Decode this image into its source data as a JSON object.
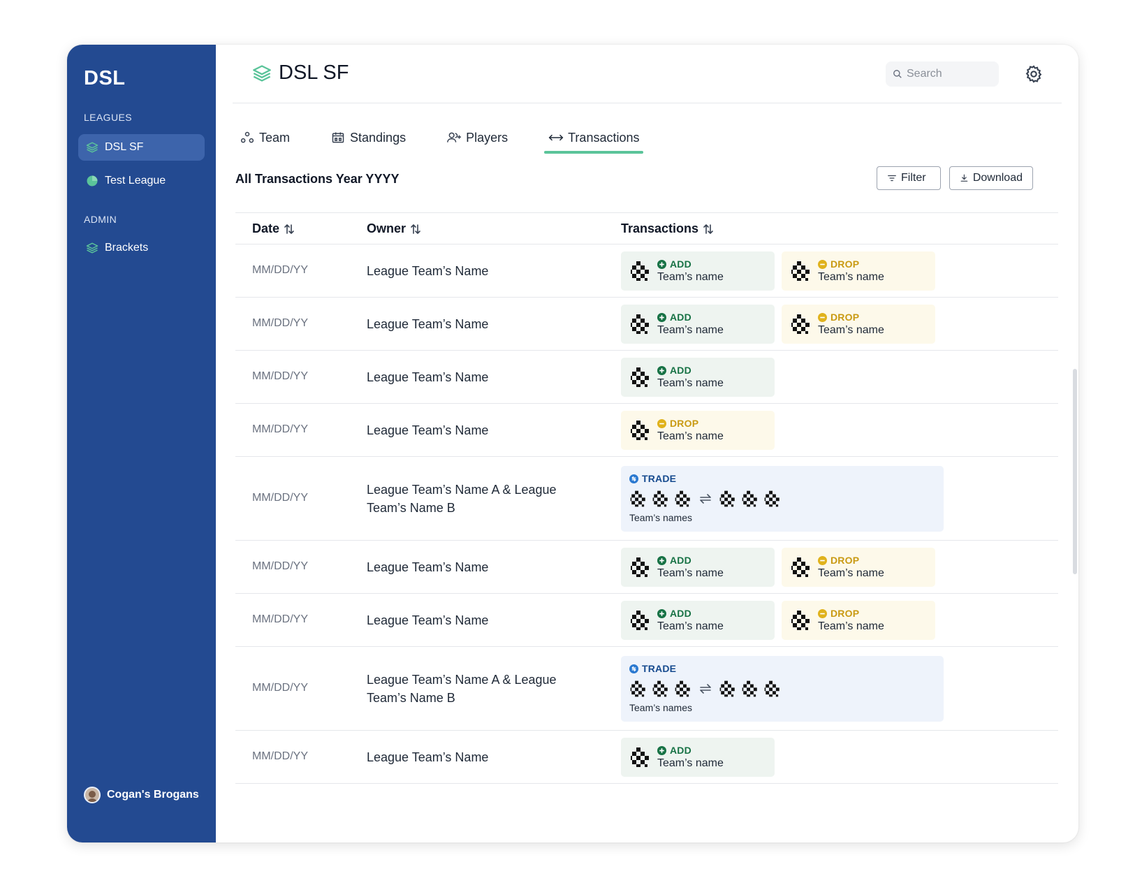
{
  "sidebar": {
    "brand": "DSL",
    "leagues_label": "LEAGUES",
    "leagues": [
      {
        "label": "DSL SF",
        "icon": "layers-icon",
        "active": true
      },
      {
        "label": "Test League",
        "icon": "pie-chart-icon",
        "active": false
      }
    ],
    "admin_label": "ADMIN",
    "admin": [
      {
        "label": "Brackets",
        "icon": "layers-icon"
      }
    ],
    "user": {
      "name": "Cogan's Brogans"
    }
  },
  "header": {
    "title": "DSL SF",
    "search_placeholder": "Search"
  },
  "tabs": [
    {
      "label": "Team",
      "icon": "team-icon",
      "active": false
    },
    {
      "label": "Standings",
      "icon": "scoreboard-icon",
      "active": false
    },
    {
      "label": "Players",
      "icon": "add-user-icon",
      "active": false
    },
    {
      "label": "Transactions",
      "icon": "arrows-left-right-icon",
      "active": true
    }
  ],
  "section_title": "All Transactions Year YYYY",
  "buttons": {
    "filter": "Filter",
    "download": "Download"
  },
  "table": {
    "columns": [
      "Date",
      "Owner",
      "Transactions"
    ],
    "rows": [
      {
        "date": "MM/DD/YY",
        "owner": "League Team’s Name",
        "items": [
          {
            "type": "ADD",
            "team": "Team’s name"
          },
          {
            "type": "DROP",
            "team": "Team’s name"
          }
        ]
      },
      {
        "date": "MM/DD/YY",
        "owner": "League Team’s Name",
        "items": [
          {
            "type": "ADD",
            "team": "Team’s name"
          },
          {
            "type": "DROP",
            "team": "Team’s name"
          }
        ]
      },
      {
        "date": "MM/DD/YY",
        "owner": "League Team’s Name",
        "items": [
          {
            "type": "ADD",
            "team": "Team’s name"
          }
        ]
      },
      {
        "date": "MM/DD/YY",
        "owner": "League Team’s Name",
        "items": [
          {
            "type": "DROP",
            "team": "Team’s name"
          }
        ]
      },
      {
        "date": "MM/DD/YY",
        "owner": "League Team’s Name A & League Team’s Name B",
        "trade": {
          "label": "TRADE",
          "names": "Team’s names"
        }
      },
      {
        "date": "MM/DD/YY",
        "owner": "League Team’s Name",
        "items": [
          {
            "type": "ADD",
            "team": "Team’s name"
          },
          {
            "type": "DROP",
            "team": "Team’s name"
          }
        ]
      },
      {
        "date": "MM/DD/YY",
        "owner": "League Team’s Name",
        "items": [
          {
            "type": "ADD",
            "team": "Team’s name"
          },
          {
            "type": "DROP",
            "team": "Team’s name"
          }
        ]
      },
      {
        "date": "MM/DD/YY",
        "owner": "League Team’s Name A & League Team’s Name B",
        "trade": {
          "label": "TRADE",
          "names": "Team’s names"
        }
      },
      {
        "date": "MM/DD/YY",
        "owner": "League Team’s Name",
        "items": [
          {
            "type": "ADD",
            "team": "Team’s name"
          }
        ]
      }
    ]
  },
  "colors": {
    "sidebar": "#234a91",
    "active_nav": "#3d64ab",
    "accent": "#5bc49a",
    "add_bg": "#eef4f0",
    "add_text": "#177245",
    "drop_bg": "#fdf9ea",
    "drop_text": "#c99a13",
    "trade_bg": "#eef3fb",
    "trade_text": "#174b8f"
  }
}
